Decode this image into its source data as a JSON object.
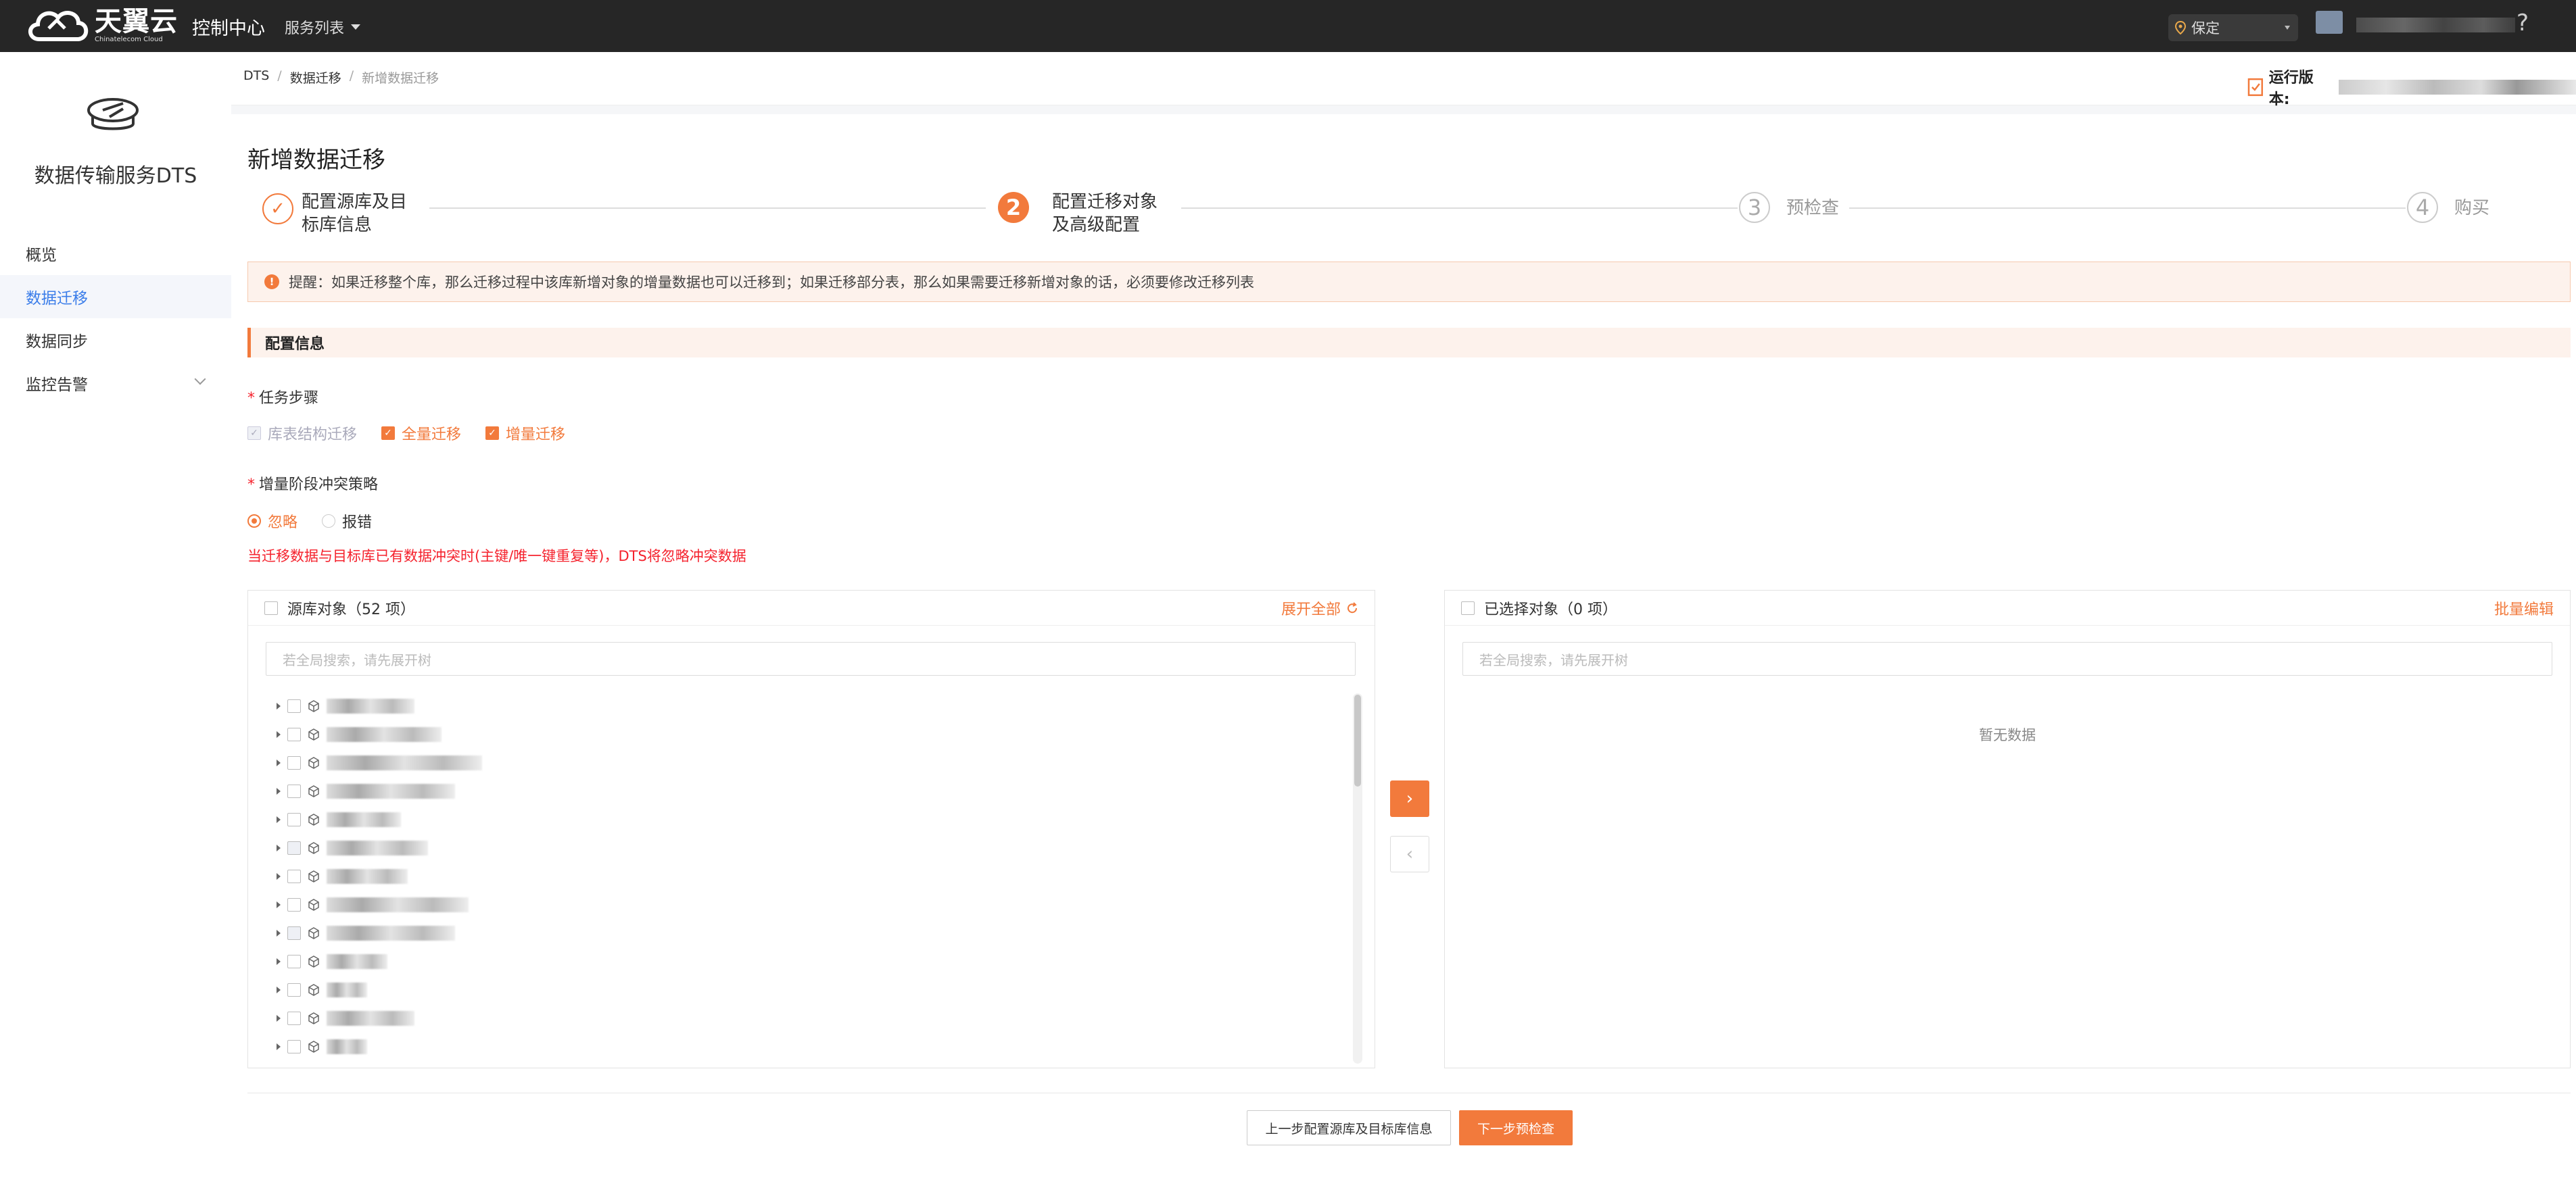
{
  "topbar": {
    "logo_cn": "天翼云",
    "logo_en": "Chinatelecom Cloud",
    "console": "控制中心",
    "services": "服务列表",
    "region": "保定",
    "help": "?"
  },
  "sidebar": {
    "title": "数据传输服务DTS",
    "items": [
      {
        "label": "概览"
      },
      {
        "label": "数据迁移"
      },
      {
        "label": "数据同步"
      },
      {
        "label": "监控告警"
      }
    ]
  },
  "breadcrumb": {
    "items": [
      "DTS",
      "数据迁移",
      "新增数据迁移"
    ],
    "sep": "/",
    "version_label": "运行版本:"
  },
  "page": {
    "title": "新增数据迁移",
    "steps": [
      {
        "num": "✓",
        "label_l1": "配置源库及目",
        "label_l2": "标库信息",
        "state": "done"
      },
      {
        "num": "2",
        "label_l1": "配置迁移对象",
        "label_l2": "及高级配置",
        "state": "active"
      },
      {
        "num": "3",
        "label_l1": "预检查",
        "label_l2": "",
        "state": "todo"
      },
      {
        "num": "4",
        "label_l1": "购买",
        "label_l2": "",
        "state": "todo"
      }
    ],
    "notice_icon": "!",
    "notice": "提醒：如果迁移整个库，那么迁移过程中该库新增对象的增量数据也可以迁移到；如果迁移部分表，那么如果需要迁移新增对象的话，必须要修改迁移列表",
    "section": "配置信息",
    "task_steps": {
      "label": "任务步骤",
      "required": "*",
      "options": [
        {
          "label": "库表结构迁移",
          "checked": true,
          "disabled": true
        },
        {
          "label": "全量迁移",
          "checked": true,
          "disabled": false
        },
        {
          "label": "增量迁移",
          "checked": true,
          "disabled": false
        }
      ]
    },
    "conflict": {
      "label": "增量阶段冲突策略",
      "required": "*",
      "options": [
        {
          "label": "忽略",
          "selected": true
        },
        {
          "label": "报错",
          "selected": false
        }
      ],
      "hint": "当迁移数据与目标库已有数据冲突时(主键/唯一键重复等)，DTS将忽略冲突数据"
    },
    "source_panel": {
      "title": "源库对象（52 项）",
      "action": "展开全部",
      "search_placeholder": "若全局搜索，请先展开树"
    },
    "target_panel": {
      "title": "已选择对象（0 项）",
      "action": "批量编辑",
      "search_placeholder": "若全局搜索，请先展开树",
      "empty": "暂无数据"
    },
    "transfer_right": "›",
    "transfer_left": "‹",
    "btn_prev": "上一步配置源库及目标库信息",
    "btn_next": "下一步预检查"
  },
  "colors": {
    "accent": "#f27a3c",
    "link": "#3b7de9",
    "error": "#f5222d",
    "topbar": "#262626"
  },
  "icons": [
    "cloud-logo-icon",
    "location-icon",
    "avatar-icon",
    "help-icon",
    "dts-icon",
    "version-icon",
    "warning-icon",
    "refresh-icon",
    "cube-icon",
    "caret-right-icon"
  ]
}
